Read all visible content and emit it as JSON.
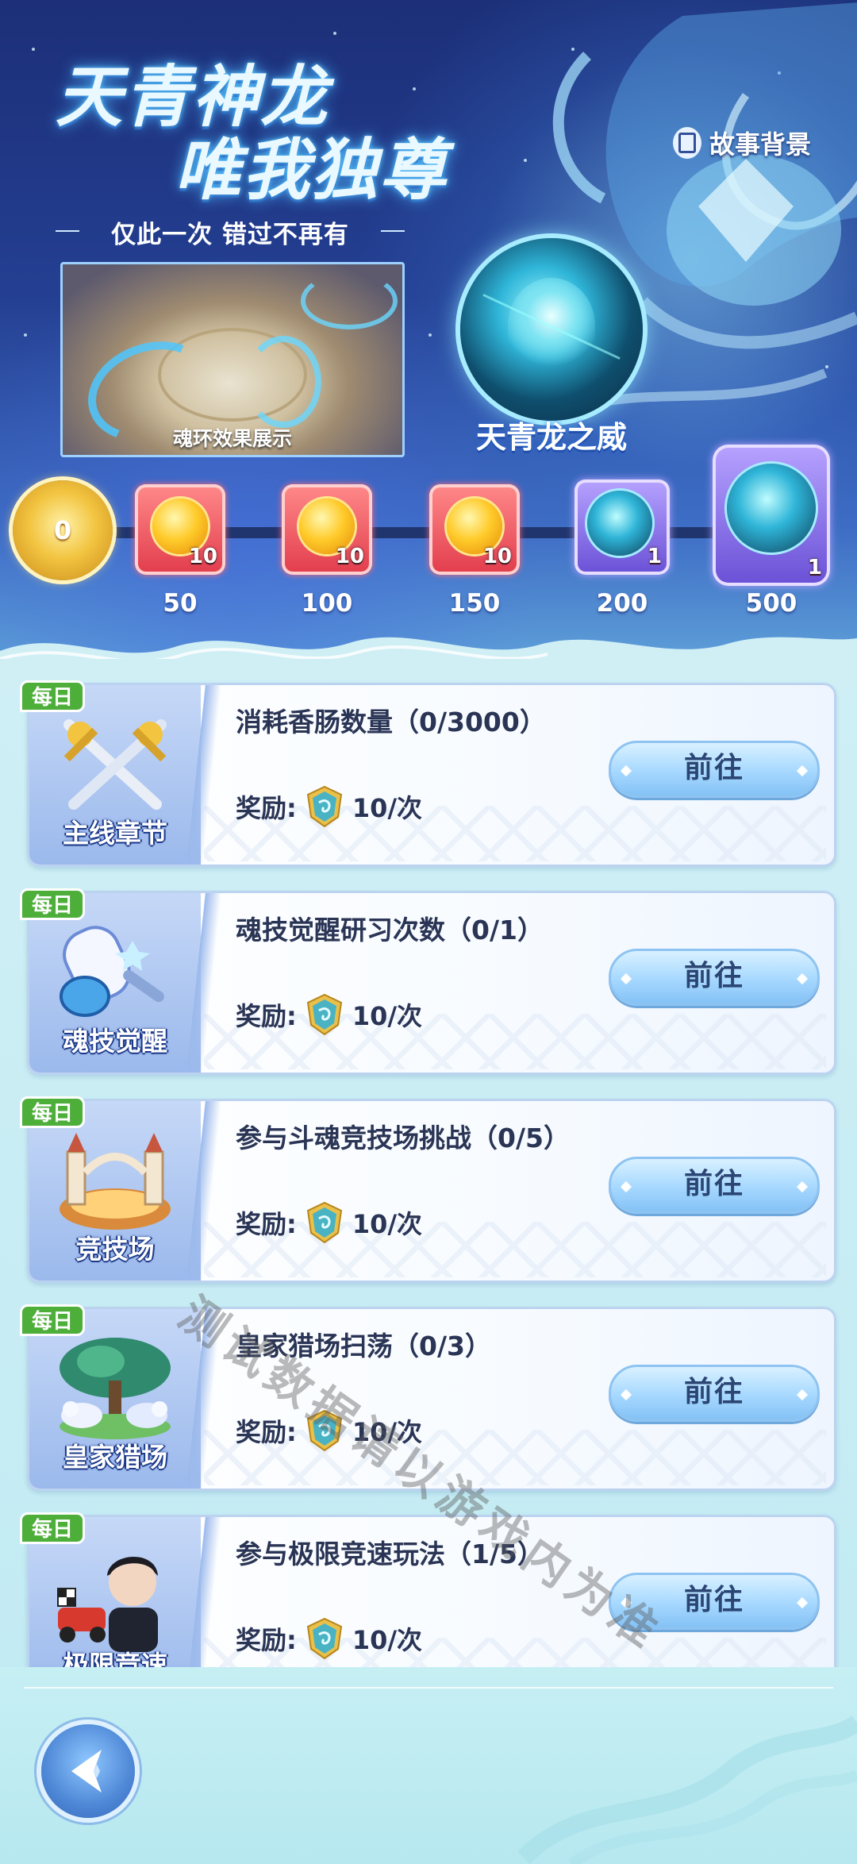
{
  "banner": {
    "title_line1": "天青神龙",
    "title_line2": "唯我独尊",
    "subtitle": "仅此一次 错过不再有",
    "story_button": "故事背景",
    "preview_caption": "魂环效果展示",
    "featured_reward": "天青龙之威"
  },
  "progress": {
    "current": "0",
    "rewards": [
      {
        "milestone": "50",
        "qty": "10",
        "type": "gold-coin"
      },
      {
        "milestone": "100",
        "qty": "10",
        "type": "gold-coin"
      },
      {
        "milestone": "150",
        "qty": "10",
        "type": "gold-coin"
      },
      {
        "milestone": "200",
        "qty": "1",
        "type": "dragon-orb"
      },
      {
        "milestone": "500",
        "qty": "1",
        "type": "dragon-orb"
      }
    ]
  },
  "tasks": [
    {
      "tag": "每日",
      "name": "主线章节",
      "title": "消耗香肠数量（0/3000）",
      "reward_label": "奖励:",
      "reward_value": "10/次",
      "button": "前往",
      "icon": "crossed-swords-icon"
    },
    {
      "tag": "每日",
      "name": "魂技觉醒",
      "title": "魂技觉醒研习次数（0/1）",
      "reward_label": "奖励:",
      "reward_value": "10/次",
      "button": "前往",
      "icon": "hammer-icon"
    },
    {
      "tag": "每日",
      "name": "竞技场",
      "title": "参与斗魂竞技场挑战（0/5）",
      "reward_label": "奖励:",
      "reward_value": "10/次",
      "button": "前往",
      "icon": "arena-icon"
    },
    {
      "tag": "每日",
      "name": "皇家猎场",
      "title": "皇家猎场扫荡（0/3）",
      "reward_label": "奖励:",
      "reward_value": "10/次",
      "button": "前往",
      "icon": "tree-wolves-icon"
    },
    {
      "tag": "每日",
      "name": "极限竞速",
      "title": "参与极限竞速玩法（1/5）",
      "reward_label": "奖励:",
      "reward_value": "10/次",
      "button": "前往",
      "icon": "racer-icon"
    }
  ],
  "watermark": "测试数据请以游戏内为准",
  "colors": {
    "banner_top": "#1c2f78",
    "daily_tag": "#4dae3a",
    "reward_red": "#e23c4c",
    "reward_purple": "#6950d6",
    "button": "#a6d8ff"
  }
}
